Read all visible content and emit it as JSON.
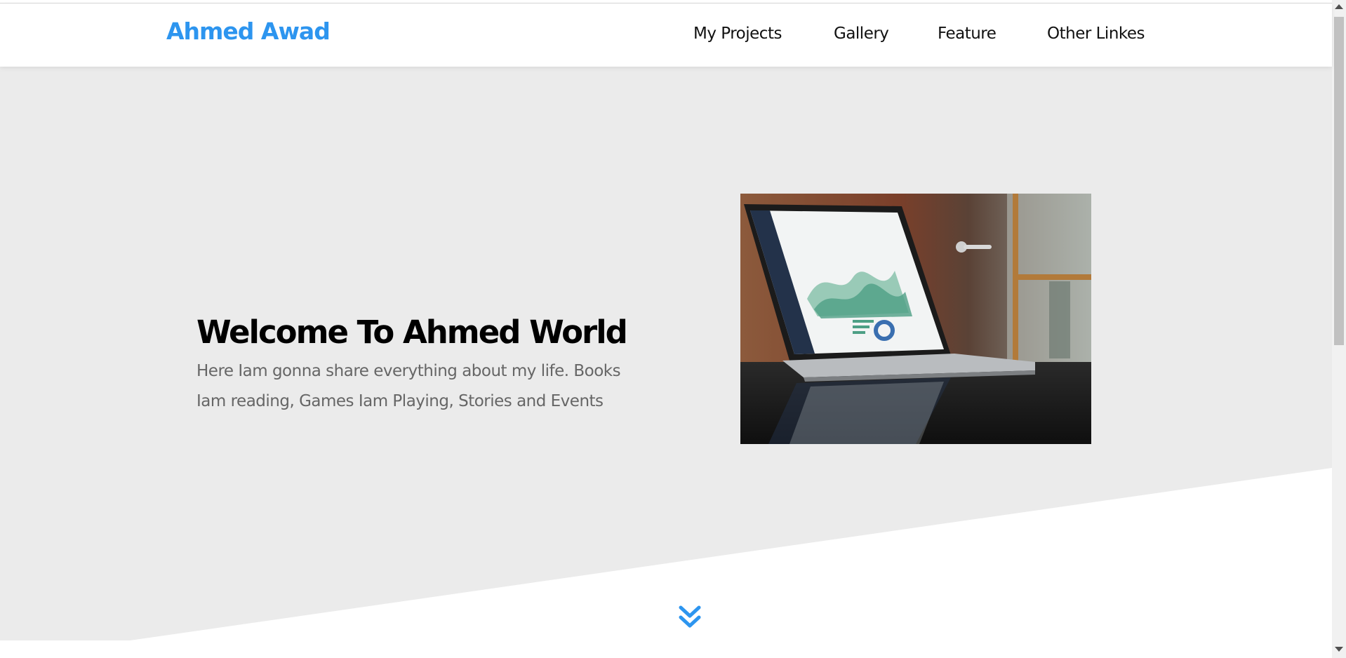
{
  "header": {
    "logo": "Ahmed Awad",
    "nav": [
      "My Projects",
      "Gallery",
      "Feature",
      "Other Linkes"
    ]
  },
  "hero": {
    "title": "Welcome To Ahmed World",
    "text": "Here Iam gonna share everything about my life. Books Iam reading, Games Iam Playing, Stories and Events",
    "image": "laptop-with-dashboard-photo"
  },
  "icons": {
    "scroll_down": "double-chevron-down-icon"
  },
  "colors": {
    "accent": "#2d95ef",
    "hero_bg": "#ebebeb",
    "text_muted": "#666666"
  }
}
